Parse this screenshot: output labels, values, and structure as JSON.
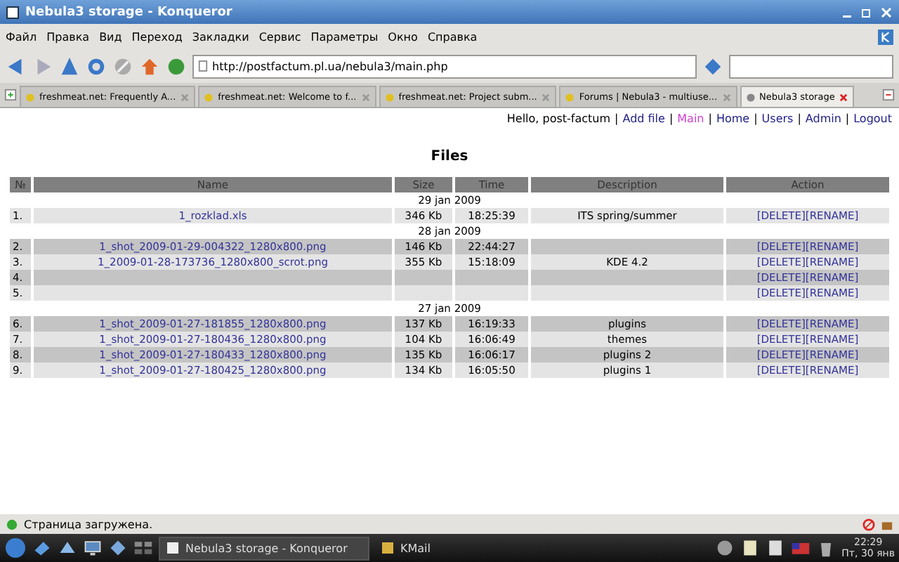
{
  "window": {
    "title": "Nebula3 storage - Konqueror"
  },
  "menu": [
    "Файл",
    "Правка",
    "Вид",
    "Переход",
    "Закладки",
    "Сервис",
    "Параметры",
    "Окно",
    "Справка"
  ],
  "address": {
    "value": "http://postfactum.pl.ua/nebula3/main.php"
  },
  "tabs": [
    {
      "label": "freshmeat.net: Frequently A...",
      "selected": false
    },
    {
      "label": "freshmeat.net: Welcome to f...",
      "selected": false
    },
    {
      "label": "freshmeat.net: Project subm...",
      "selected": false
    },
    {
      "label": "Forums | Nebula3 - multiuse...",
      "selected": false
    },
    {
      "label": "Nebula3 storage",
      "selected": true
    }
  ],
  "greeting": "Hello, post-factum",
  "nav": [
    {
      "separator": "|",
      "label": "Add file",
      "selected": false
    },
    {
      "separator": "|",
      "label": "Main",
      "selected": true
    },
    {
      "separator": "|",
      "label": "Home",
      "selected": false
    },
    {
      "separator": "|",
      "label": "Users",
      "selected": false
    },
    {
      "separator": "|",
      "label": "Admin",
      "selected": false
    },
    {
      "separator": "|",
      "label": "Logout",
      "selected": false
    }
  ],
  "heading": "Files",
  "table": {
    "columns": [
      "№",
      "Name",
      "Size",
      "Time",
      "Description",
      "Action"
    ],
    "rows": [
      {
        "kind": "date",
        "text": "29 jan 2009"
      },
      {
        "kind": "file",
        "no": "1.",
        "name": "1_rozklad.xls",
        "size": "346 Kb",
        "time": "18:25:39",
        "description": "ITS spring/summer",
        "actions": [
          "[DELETE]",
          "[RENAME]"
        ]
      },
      {
        "kind": "date",
        "text": "28 jan 2009"
      },
      {
        "kind": "file",
        "no": "2.",
        "name": "1_shot_2009-01-29-004322_1280x800.png",
        "size": "146 Kb",
        "time": "22:44:27",
        "actions": [
          "[DELETE]",
          "[RENAME]"
        ]
      },
      {
        "kind": "file",
        "no": "3.",
        "name": "1_2009-01-28-173736_1280x800_scrot.png",
        "size": "355 Kb",
        "time": "15:18:09",
        "description": "KDE 4.2",
        "actions": [
          "[DELETE]",
          "[RENAME]"
        ]
      },
      {
        "kind": "file",
        "no": "4.",
        "actions": [
          "[DELETE]",
          "[RENAME]"
        ]
      },
      {
        "kind": "file",
        "no": "5.",
        "actions": [
          "[DELETE]",
          "[RENAME]"
        ]
      },
      {
        "kind": "date",
        "text": "27 jan 2009"
      },
      {
        "kind": "file",
        "no": "6.",
        "name": "1_shot_2009-01-27-181855_1280x800.png",
        "size": "137 Kb",
        "time": "16:19:33",
        "description": "plugins",
        "actions": [
          "[DELETE]",
          "[RENAME]"
        ]
      },
      {
        "kind": "file",
        "no": "7.",
        "name": "1_shot_2009-01-27-180436_1280x800.png",
        "size": "104 Kb",
        "time": "16:06:49",
        "description": "themes",
        "actions": [
          "[DELETE]",
          "[RENAME]"
        ]
      },
      {
        "kind": "file",
        "no": "8.",
        "name": "1_shot_2009-01-27-180433_1280x800.png",
        "size": "135 Kb",
        "time": "16:06:17",
        "description": "plugins 2",
        "actions": [
          "[DELETE]",
          "[RENAME]"
        ]
      },
      {
        "kind": "file",
        "no": "9.",
        "name": "1_shot_2009-01-27-180425_1280x800.png",
        "size": "134 Kb",
        "time": "16:05:50",
        "description": "plugins 1",
        "actions": [
          "[DELETE]",
          "[RENAME]"
        ]
      }
    ]
  },
  "status_bar": "Страница загружена.",
  "taskbar": {
    "windows": [
      {
        "label": "Nebula3 storage - Konqueror",
        "selected": true
      },
      {
        "label": "KMail",
        "selected": false
      }
    ],
    "time": "22:29",
    "date": "Пт, 30 янв"
  }
}
